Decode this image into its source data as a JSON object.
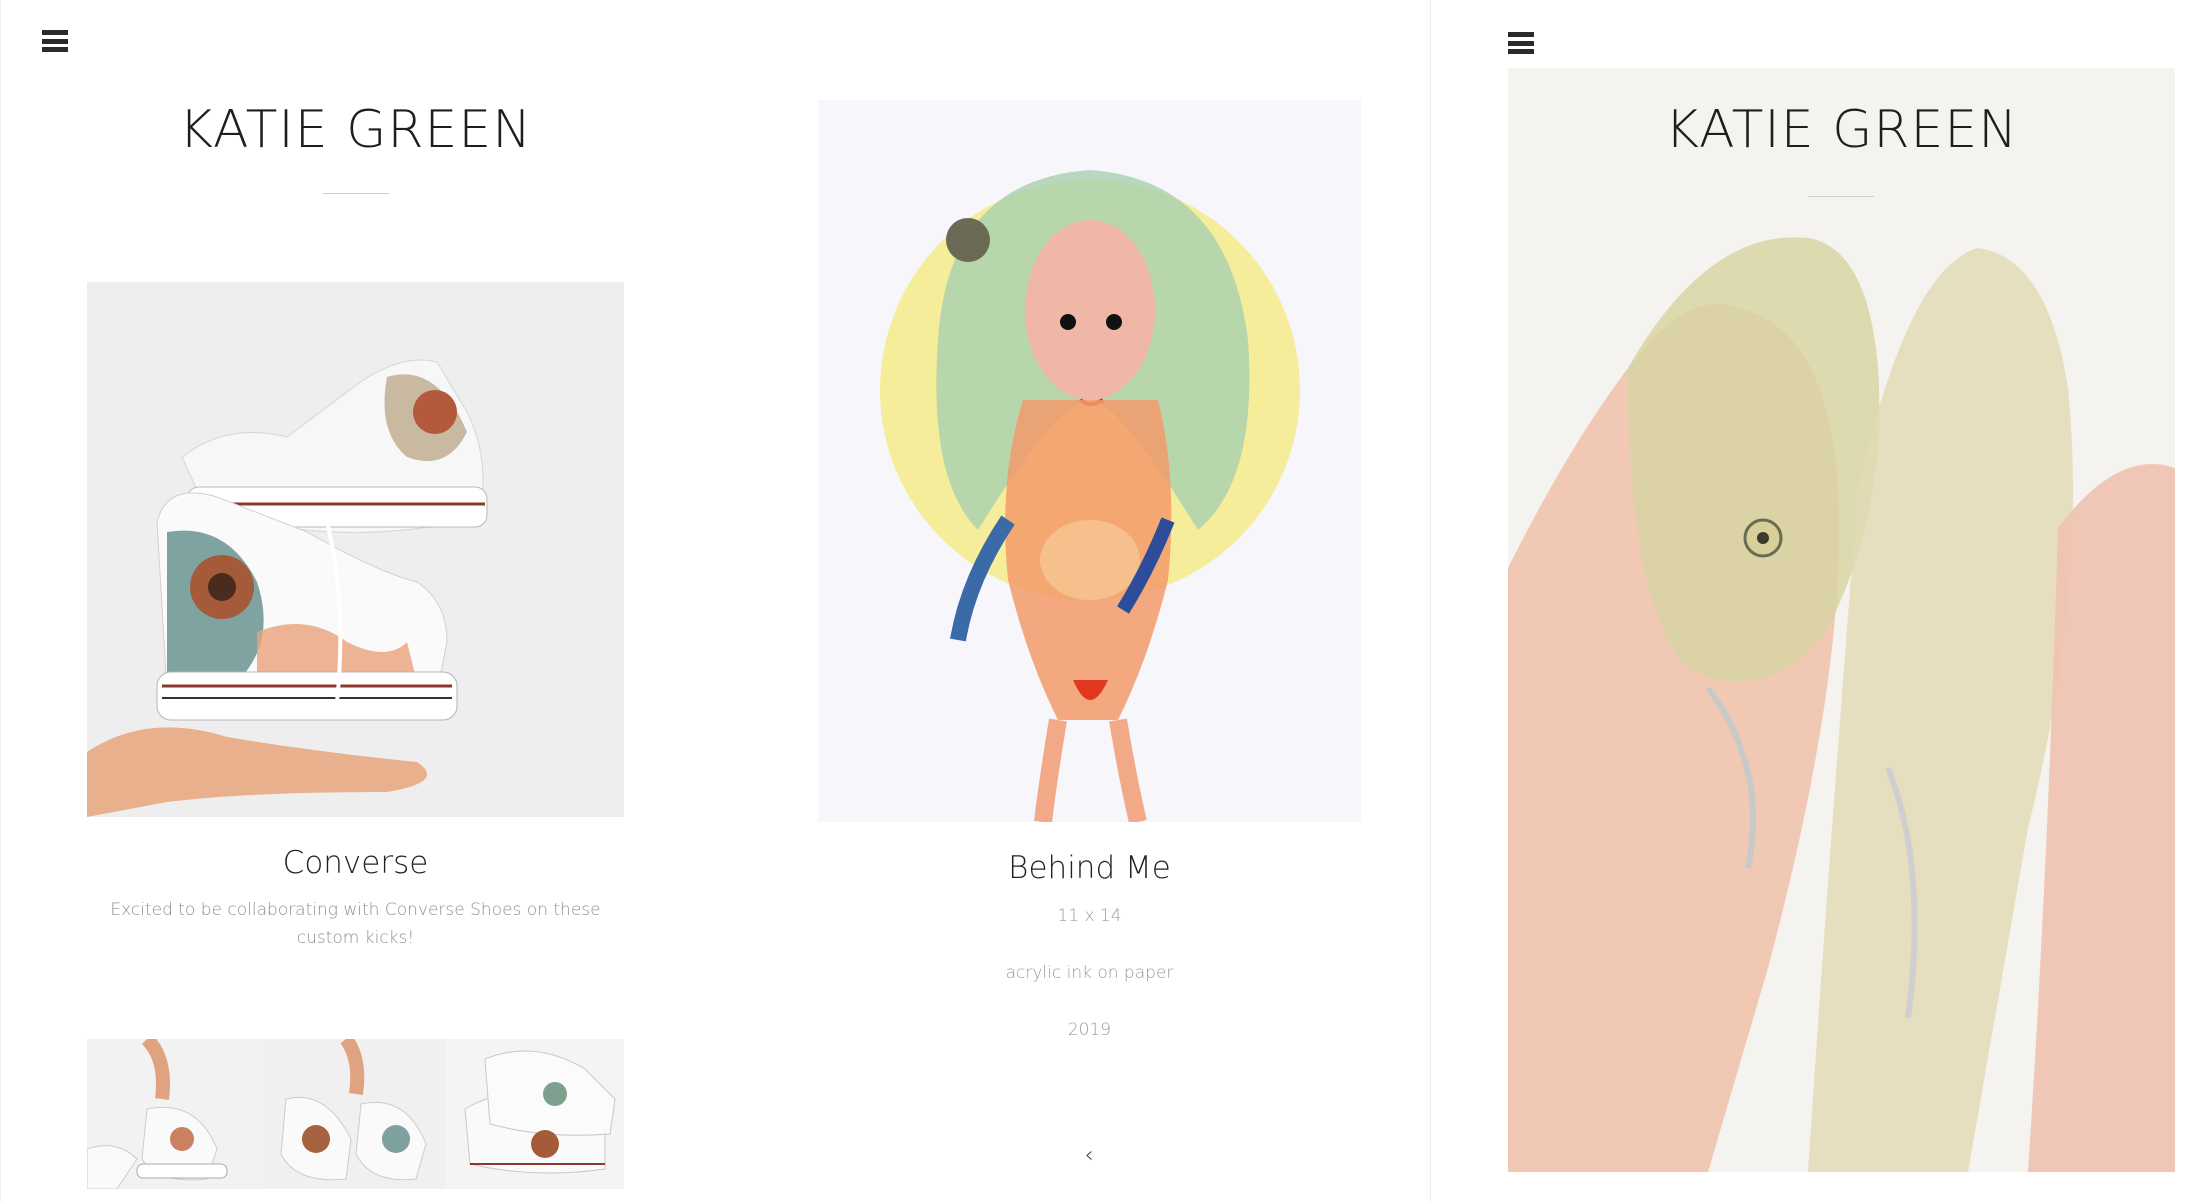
{
  "left_panel": {
    "menu_icon": "hamburger-menu-icon",
    "brand": "KATIE GREEN"
  },
  "post_converse": {
    "title": "Converse",
    "caption": "Excited to be collaborating with Converse Shoes on these custom kicks!",
    "image": "painted-converse-high-tops-artwork",
    "thumbnails": [
      "hand-holding-converse-by-laces",
      "hand-holding-two-converse-sneakers",
      "pair-of-converse-on-white"
    ]
  },
  "post_behind_me": {
    "title": "Behind Me",
    "size": "11 x 14",
    "medium": "acrylic ink on paper",
    "year": "2019",
    "image": "watercolor-creature-figure-painting",
    "back_icon": "chevron-left-icon",
    "back_glyph": "‹"
  },
  "right_panel": {
    "menu_icon": "hamburger-menu-icon",
    "brand": "KATIE GREEN",
    "hero_image": "watercolor-salmon-painting"
  },
  "colors": {
    "text_dark": "#1e1e1e",
    "text_muted": "#8f8f8f",
    "rule": "#cfcfcf",
    "background": "#ffffff"
  }
}
